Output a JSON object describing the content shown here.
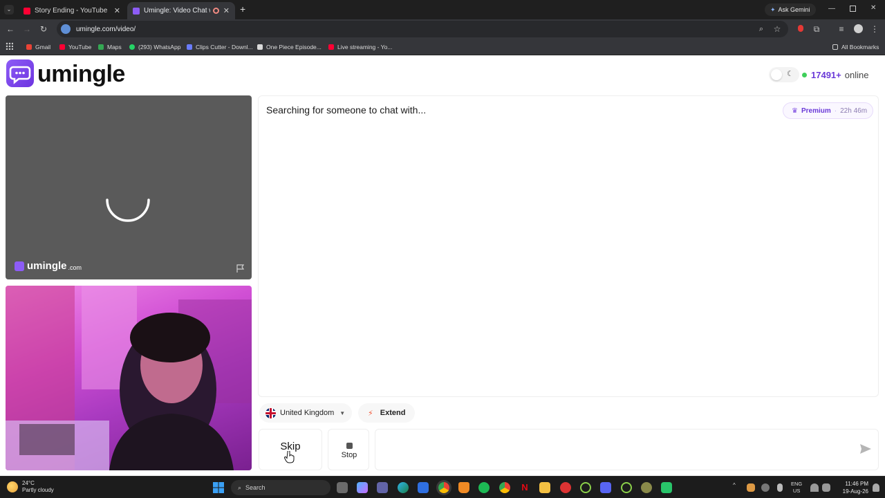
{
  "browser": {
    "tabs": [
      {
        "title": "Story Ending - YouTube",
        "active": false,
        "favicon_color": "#ff0033"
      },
      {
        "title": "Umingle: Video Chat with St",
        "active": true,
        "favicon_color": "#8d5cf6"
      }
    ],
    "new_tab_label": "+",
    "ask_gemini_label": "Ask Gemini",
    "url": "umingle.com/video/",
    "bookmarks": [
      {
        "label": "Gmail",
        "color": "#ea4335"
      },
      {
        "label": "YouTube",
        "color": "#ff0033"
      },
      {
        "label": "Maps",
        "color": "#34a853"
      },
      {
        "label": "(293) WhatsApp",
        "color": "#25d366"
      },
      {
        "label": "Clips Cutter - Downl...",
        "color": "#6a7cff"
      },
      {
        "label": "One Piece Episode...",
        "color": "#d9d9d9"
      },
      {
        "label": "Live streaming - Yo...",
        "color": "#ff0033"
      }
    ],
    "all_bookmarks_label": "All Bookmarks"
  },
  "header": {
    "logo_text": "umingle",
    "online_count": "17491+",
    "online_label": "online"
  },
  "remote_video": {
    "watermark": "umingle",
    "watermark_suffix": ".com"
  },
  "chat": {
    "status": "Searching for someone to chat with...",
    "premium_label": "Premium",
    "premium_separator": "·",
    "premium_time": "22h 46m"
  },
  "controls": {
    "country": "United Kingdom",
    "extend_label": "Extend",
    "skip_label": "Skip",
    "stop_label": "Stop",
    "message_placeholder": ""
  },
  "taskbar": {
    "temperature": "24°C",
    "weather": "Partly cloudy",
    "search_label": "Search",
    "language": "ENG",
    "region": "US",
    "time": "11:46 PM",
    "date": "19-Aug-26"
  },
  "colors": {
    "brand": "#8d5cf6",
    "online_dot": "#3fcf5a"
  }
}
